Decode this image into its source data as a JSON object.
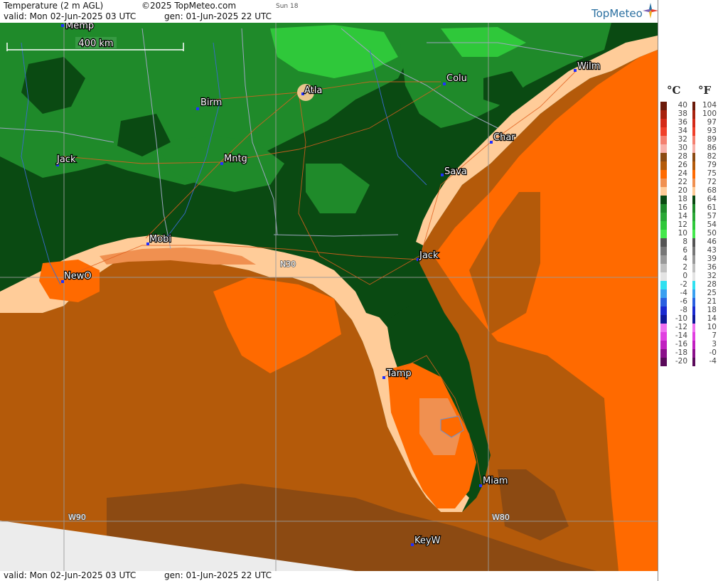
{
  "header": {
    "title": "Temperature (2 m AGL)",
    "copyright": "©2025 TopMeteo.com",
    "day": "Sun 18",
    "valid": "valid:  Mon  02-Jun-2025  03 UTC",
    "generated": "gen:  01-Jun-2025 22 UTC"
  },
  "logo": {
    "text": "TopMeteo"
  },
  "footer": {
    "valid": "valid:  Mon  02-Jun-2025  03 UTC",
    "generated": "gen:  01-Jun-2025 22 UTC"
  },
  "map": {
    "scale_label": "400 km",
    "grid_labels": {
      "lat": "N30",
      "lon1": "W90",
      "lon2": "W80"
    },
    "cities": [
      {
        "name": "Birm"
      },
      {
        "name": "Atla"
      },
      {
        "name": "Colu"
      },
      {
        "name": "Wilm"
      },
      {
        "name": "Char"
      },
      {
        "name": "Sava"
      },
      {
        "name": "Jack"
      },
      {
        "name": "Mntg"
      },
      {
        "name": "Mobi"
      },
      {
        "name": "NewO"
      },
      {
        "name": "Jack"
      },
      {
        "name": "Tamp"
      },
      {
        "name": "Miam"
      },
      {
        "name": "KeyW"
      },
      {
        "name": "Memp"
      }
    ],
    "colors": {
      "water_warm": "#b45a0a",
      "water_hot": "#8c4a12",
      "coastal_orange": "#ff6a00",
      "light_orange": "#f09050",
      "peach": "#ffcc99",
      "dark_green": "#0a4a12",
      "mid_green": "#1f8a2a",
      "bright_green": "#2fc83a",
      "nodata": "#ececec"
    }
  },
  "legend": {
    "unit_c": "°C",
    "unit_f": "°F",
    "rows": [
      {
        "c": "40",
        "f": "104",
        "color": "#6b1a0a"
      },
      {
        "c": "38",
        "f": "100",
        "color": "#a8220e"
      },
      {
        "c": "36",
        "f": "97",
        "color": "#d42a18"
      },
      {
        "c": "34",
        "f": "93",
        "color": "#f0402a"
      },
      {
        "c": "32",
        "f": "89",
        "color": "#f48070"
      },
      {
        "c": "30",
        "f": "86",
        "color": "#f8b0a8"
      },
      {
        "c": "28",
        "f": "82",
        "color": "#8c4a12"
      },
      {
        "c": "26",
        "f": "79",
        "color": "#b45a0a"
      },
      {
        "c": "24",
        "f": "75",
        "color": "#ff6a00"
      },
      {
        "c": "22",
        "f": "72",
        "color": "#f09050"
      },
      {
        "c": "20",
        "f": "68",
        "color": "#ffcc99"
      },
      {
        "c": "18",
        "f": "64",
        "color": "#0a4a12"
      },
      {
        "c": "16",
        "f": "61",
        "color": "#1f8a2a"
      },
      {
        "c": "14",
        "f": "57",
        "color": "#2aa836"
      },
      {
        "c": "12",
        "f": "54",
        "color": "#2fc83a"
      },
      {
        "c": "10",
        "f": "50",
        "color": "#44e84c"
      },
      {
        "c": "8",
        "f": "46",
        "color": "#555555"
      },
      {
        "c": "6",
        "f": "43",
        "color": "#777777"
      },
      {
        "c": "4",
        "f": "39",
        "color": "#999999"
      },
      {
        "c": "2",
        "f": "36",
        "color": "#c0c0c0"
      },
      {
        "c": "0",
        "f": "32",
        "color": "#e4e4e4"
      },
      {
        "c": "-2",
        "f": "28",
        "color": "#30e0f0"
      },
      {
        "c": "-4",
        "f": "25",
        "color": "#3aa0f0"
      },
      {
        "c": "-6",
        "f": "21",
        "color": "#2a60e0"
      },
      {
        "c": "-8",
        "f": "18",
        "color": "#1a2ad0"
      },
      {
        "c": "-10",
        "f": "14",
        "color": "#10189a"
      },
      {
        "c": "-12",
        "f": "10",
        "color": "#f070f0"
      },
      {
        "c": "-14",
        "f": "7",
        "color": "#e040e0"
      },
      {
        "c": "-16",
        "f": "3",
        "color": "#c020c0"
      },
      {
        "c": "-18",
        "f": "-0",
        "color": "#8a108a"
      },
      {
        "c": "-20",
        "f": "-4",
        "color": "#5a0a5a"
      }
    ]
  }
}
